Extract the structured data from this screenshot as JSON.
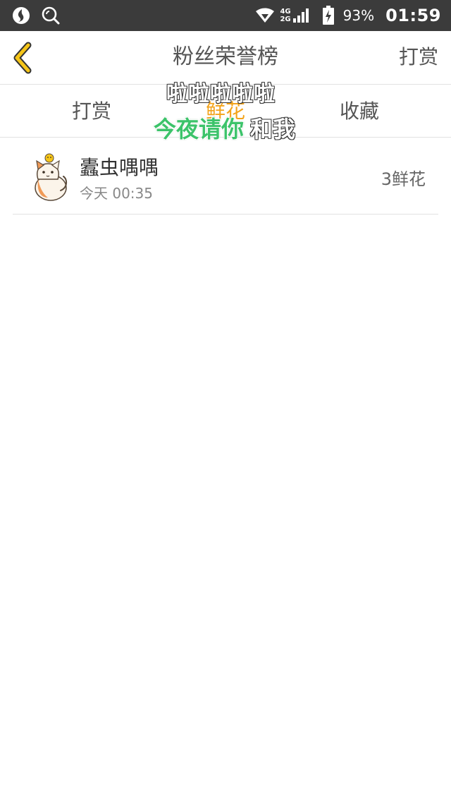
{
  "status_bar": {
    "network_top": "4G",
    "network_bottom": "2G",
    "battery": "93%",
    "time": "01:59",
    "icons": [
      "app-icon",
      "search-icon",
      "wifi-icon",
      "signal-icon",
      "battery-icon"
    ]
  },
  "navbar": {
    "title": "粉丝荣誉榜",
    "action_label": "打赏"
  },
  "tabs": [
    {
      "label": "打赏",
      "active": false
    },
    {
      "label": "鲜花",
      "active": true
    },
    {
      "label": "收藏",
      "active": false
    }
  ],
  "overlay": {
    "line1": "啦啦啦啦啦",
    "line2_green": "今夜请你",
    "line2_white": "和我"
  },
  "list": [
    {
      "name": "蠹虫喁喁",
      "time": "今天 00:35",
      "amount": "3鲜花",
      "avatar": "cat-avatar-icon"
    }
  ],
  "colors": {
    "status_bar_bg": "#3b3b3b",
    "active_tab": "#f3a31a",
    "back_icon": "#f5c518",
    "overlay_green": "#3cc36a"
  }
}
